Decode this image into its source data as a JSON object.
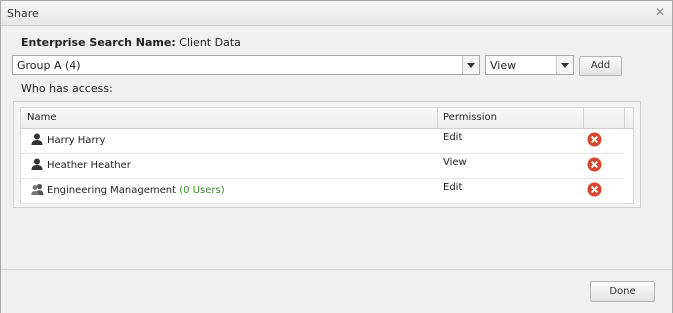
{
  "dialog": {
    "title": "Share"
  },
  "enterprise_search": {
    "label": "Enterprise Search Name:",
    "value": "Client Data"
  },
  "group_select": {
    "value": "Group A (4)"
  },
  "permission_select": {
    "value": "View"
  },
  "add_button": "Add",
  "who_has_access_label": "Who has access:",
  "grid": {
    "headers": {
      "name": "Name",
      "permission": "Permission"
    },
    "rows": [
      {
        "name": "Harry Harry",
        "users": "",
        "permission": "Edit",
        "icon": "user-icon"
      },
      {
        "name": "Heather Heather",
        "users": "",
        "permission": "View",
        "icon": "user-icon"
      },
      {
        "name": "Engineering Management",
        "users": "(0 Users)",
        "permission": "Edit",
        "icon": "group-icon"
      }
    ]
  },
  "done_button": "Done",
  "colors": {
    "delete": "#d9442b",
    "users_count": "#3a8a2b"
  }
}
